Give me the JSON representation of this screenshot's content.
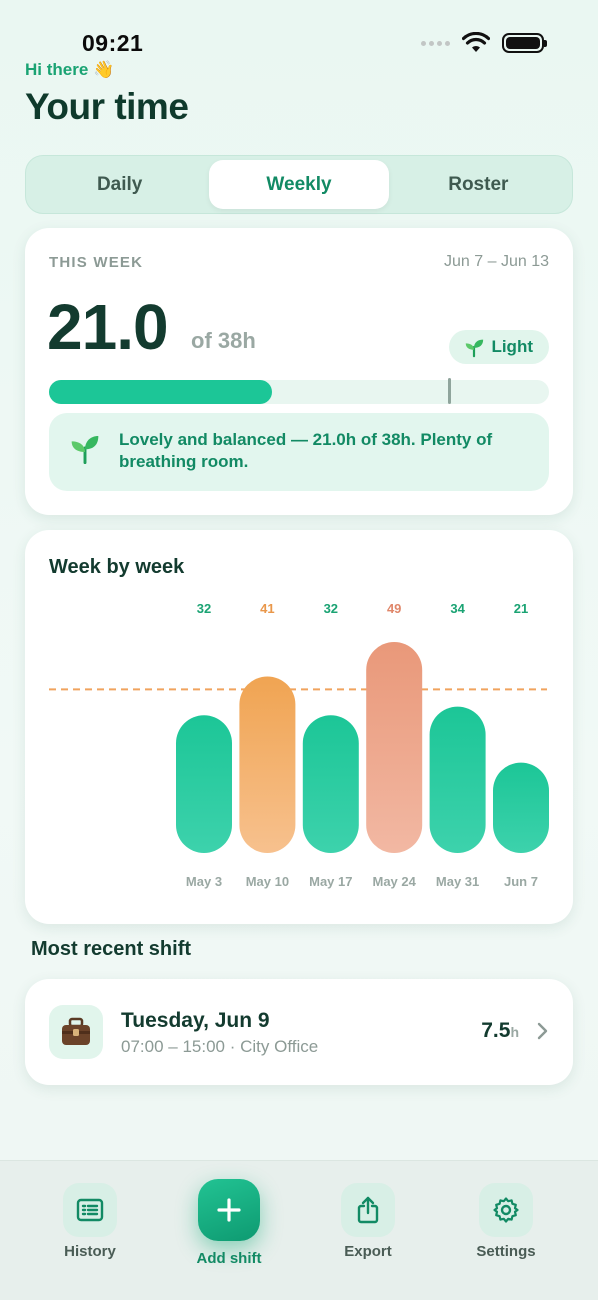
{
  "status_bar": {
    "time": "09:21"
  },
  "header": {
    "greeting": "Hi there 👋",
    "title": "Your time"
  },
  "tabs": [
    {
      "label": "Daily",
      "active": false
    },
    {
      "label": "Weekly",
      "active": true
    },
    {
      "label": "Roster",
      "active": false
    }
  ],
  "this_week": {
    "label": "THIS WEEK",
    "range": "Jun 7 – Jun 13",
    "hours": "21.0",
    "of_text": "of 38h",
    "badge": "Light",
    "progress": 0.445,
    "marker": 0.8,
    "message": "Lovely and balanced — 21.0h of 38h. Plenty of breathing room."
  },
  "chart_data": {
    "type": "bar",
    "title": "Week by week",
    "categories": [
      "May 3",
      "May 10",
      "May 17",
      "May 24",
      "May 31",
      "Jun 7"
    ],
    "values": [
      32,
      41,
      32,
      49,
      34,
      21
    ],
    "value_labels": [
      "32",
      "41",
      "32",
      "49",
      "34",
      "21"
    ],
    "target_line": 38,
    "colors": {
      "under": "#1cc697",
      "over_light": "#f0a85a",
      "over_heavy": "#ea9b80",
      "target": "#f0a35e"
    },
    "bar_color_kind": [
      "under",
      "over_light",
      "under",
      "over_heavy",
      "under",
      "under"
    ]
  },
  "recent_shift": {
    "section_title": "Most recent shift",
    "date": "Tuesday, Jun 9",
    "detail": "07:00 – 15:00 · City Office",
    "hours": "7.5",
    "unit": "h",
    "icon": "briefcase-icon"
  },
  "nav": {
    "history": "History",
    "add": "Add shift",
    "export": "Export",
    "settings": "Settings"
  }
}
